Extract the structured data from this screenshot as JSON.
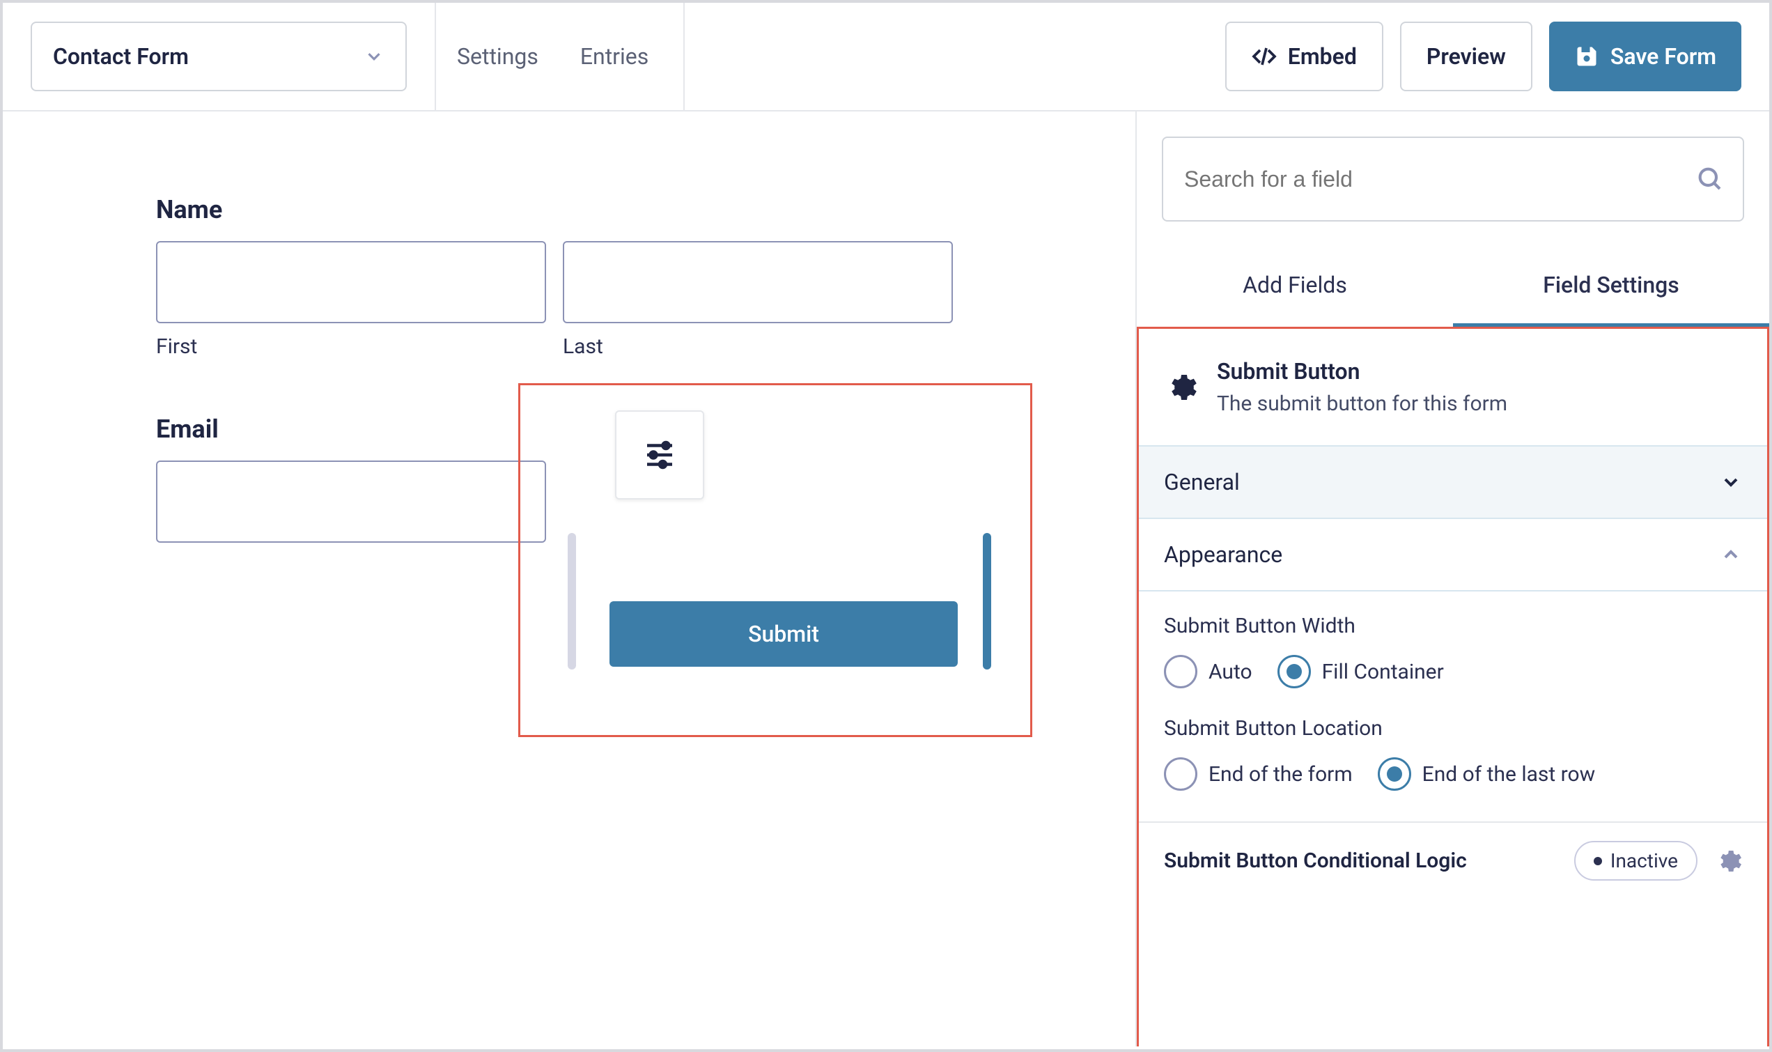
{
  "topbar": {
    "form_name": "Contact Form",
    "tabs": {
      "settings": "Settings",
      "entries": "Entries"
    },
    "embed": "Embed",
    "preview": "Preview",
    "save": "Save Form"
  },
  "canvas": {
    "name_label": "Name",
    "first_label": "First",
    "last_label": "Last",
    "email_label": "Email",
    "submit_label": "Submit"
  },
  "sidebar": {
    "search_placeholder": "Search for a field",
    "tabs": {
      "add": "Add Fields",
      "settings": "Field Settings"
    },
    "field": {
      "title": "Submit Button",
      "desc": "The submit button for this form"
    },
    "sections": {
      "general": "General",
      "appearance": "Appearance"
    },
    "width": {
      "label": "Submit Button Width",
      "opts": {
        "auto": "Auto",
        "fill": "Fill Container"
      }
    },
    "location": {
      "label": "Submit Button Location",
      "opts": {
        "end_form": "End of the form",
        "end_row": "End of the last row"
      }
    },
    "cond": {
      "label": "Submit Button Conditional Logic",
      "status": "Inactive"
    }
  }
}
